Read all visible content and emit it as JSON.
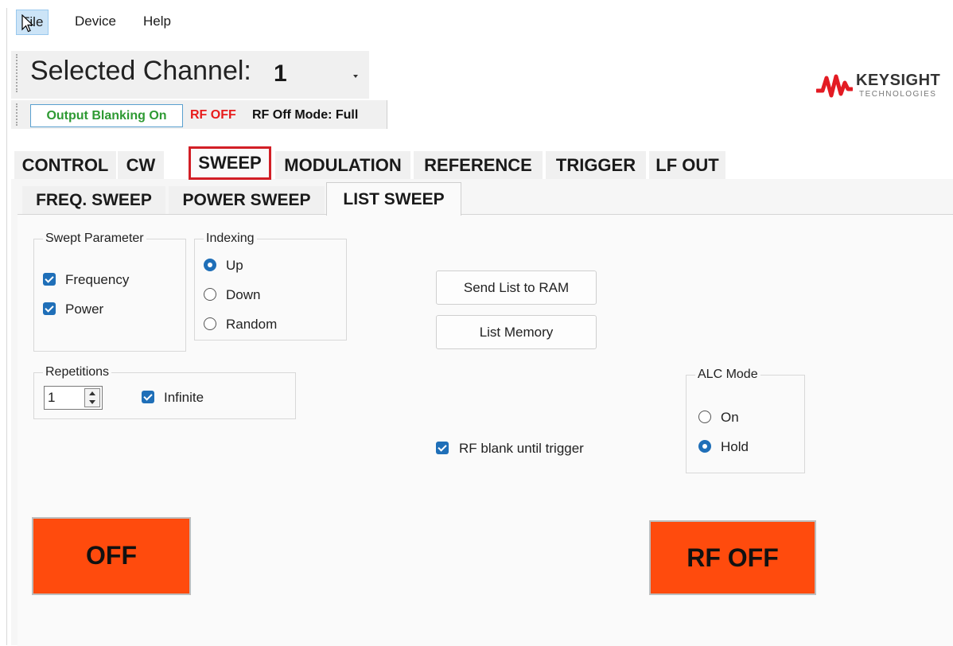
{
  "menu": {
    "items": [
      {
        "label": "File"
      },
      {
        "label": "Device"
      },
      {
        "label": "Help"
      }
    ]
  },
  "toolbar": {
    "channel_label": "Selected Channel:",
    "channel_value": "1",
    "output_blanking": "Output Blanking On",
    "rf_status": "RF OFF",
    "rf_off_mode": "RF Off Mode: Full"
  },
  "logo": {
    "name": "KEYSIGHT",
    "sub": "TECHNOLOGIES"
  },
  "main_tabs": [
    {
      "label": "CONTROL"
    },
    {
      "label": "CW"
    },
    {
      "label": "SWEEP"
    },
    {
      "label": "MODULATION"
    },
    {
      "label": "REFERENCE"
    },
    {
      "label": "TRIGGER"
    },
    {
      "label": "LF OUT"
    }
  ],
  "sub_tabs": [
    {
      "label": "FREQ. SWEEP"
    },
    {
      "label": "POWER SWEEP"
    },
    {
      "label": "LIST SWEEP"
    }
  ],
  "swept_parameter": {
    "title": "Swept Parameter",
    "options": [
      {
        "label": "Frequency",
        "checked": true
      },
      {
        "label": "Power",
        "checked": true
      }
    ]
  },
  "indexing": {
    "title": "Indexing",
    "options": [
      {
        "label": "Up",
        "selected": true
      },
      {
        "label": "Down",
        "selected": false
      },
      {
        "label": "Random",
        "selected": false
      }
    ]
  },
  "buttons": {
    "send_list": "Send List to RAM",
    "list_memory": "List Memory"
  },
  "repetitions": {
    "title": "Repetitions",
    "value": "1",
    "infinite_label": "Infinite",
    "infinite_checked": true
  },
  "rf_blank": {
    "label": "RF blank until trigger",
    "checked": true
  },
  "alc_mode": {
    "title": "ALC Mode",
    "options": [
      {
        "label": "On",
        "selected": false
      },
      {
        "label": "Hold",
        "selected": true
      }
    ]
  },
  "big_buttons": {
    "sweep_off": "OFF",
    "rf_off": "RF OFF"
  },
  "colors": {
    "accent_blue": "#1f6fb8",
    "off_orange": "#ff4b0d",
    "blanking_green": "#2e9a33",
    "rf_red": "#e81c1c",
    "active_tab_border": "#d21f26"
  }
}
